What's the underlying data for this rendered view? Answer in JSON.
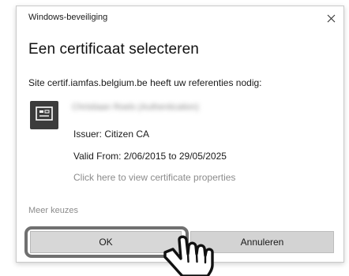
{
  "window": {
    "title": "Windows-beveiliging",
    "close_glyph": "✕"
  },
  "dialog": {
    "heading": "Een certificaat selecteren",
    "site_message": "Site certif.iamfas.belgium.be heeft uw referenties nodig:"
  },
  "certificate": {
    "icon": "certificate-card-icon",
    "name": "Christiaan Roels (Authentication)",
    "issuer": "Issuer: Citizen CA",
    "valid": "Valid From: 2/06/2015 to 29/05/2025",
    "properties_link": "Click here to view certificate properties"
  },
  "more_choices": "Meer keuzes",
  "buttons": {
    "ok": "OK",
    "cancel": "Annuleren"
  },
  "overlay": {
    "cursor": "pointing-hand-icon",
    "highlight": "ok-button-highlight"
  },
  "colors": {
    "link_gray": "#8c8c8c",
    "button_gray": "#d7d7d7",
    "highlight_border": "#707070",
    "cert_icon_bg": "#3c3c3c"
  }
}
